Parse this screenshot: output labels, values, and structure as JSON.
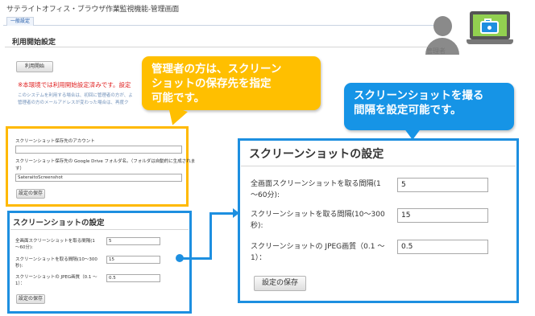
{
  "app": {
    "title": "サテライトオフィス・ブラウザ作業監視機能-管理画面",
    "tab_general": "一般設定"
  },
  "usage": {
    "title": "利用開始設定",
    "start_button": "利用開始",
    "warning": "※本環境では利用開始設定済みです。設定",
    "note_line_1": "このシステムを利用する場合は、初回に管理者の方が、よ",
    "note_line_2": "管理者の方のメールアドレスが変わった場合は、再度ク"
  },
  "account": {
    "account_label": "スクリーンショット保存先のアカウント",
    "account_value": "",
    "folder_label": "スクリーンショット保存先の Google Drive フォルダ名。（フォルダは自動的に生成されま",
    "folder_label_line_2": "す）",
    "folder_value": "SateraitoScreenshot",
    "save_button": "設定の保存"
  },
  "screenshot_small": {
    "title": "スクリーンショットの設定",
    "full_interval_label_1": "全画面スクリーンショットを取る間隔(1",
    "full_interval_label_2": "～60分):",
    "full_interval_value": "5",
    "interval_label_1": "スクリーンショットを取る間隔(10～300",
    "interval_label_2": "秒):",
    "interval_value": "15",
    "jpeg_label_1": "スクリーンショットの JPEG画質（0.1 ～",
    "jpeg_label_2": "1）：",
    "jpeg_value": "0.5",
    "save_button": "設定の保存"
  },
  "screenshot_zoom": {
    "title": "スクリーンショットの設定",
    "full_interval_label_1": "全画面スクリーンショットを取る間隔(1",
    "full_interval_label_2": "～60分):",
    "full_interval_value": "5",
    "interval_label_1": "スクリーンショットを取る間隔(10～300",
    "interval_label_2": "秒):",
    "interval_value": "15",
    "jpeg_label_1": "スクリーンショットの JPEG画質（0.1 ～",
    "jpeg_label_2": "1）：",
    "jpeg_value": "0.5",
    "save_button": "設定の保存"
  },
  "callouts": {
    "orange_line_1": "管理者の方は、スクリーン",
    "orange_line_2": "ショットの保存先を指定",
    "orange_line_3": "可能です。",
    "blue_line_1": "スクリーンショットを撮る",
    "blue_line_2": "間隔を設定可能です。"
  },
  "icons": {
    "admin_icon": "person-silhouette-icon",
    "laptop_icon": "laptop-camera-icon"
  },
  "admin_label": "管理者",
  "colors": {
    "callout_orange": "#ffbf00",
    "highlight_blue": "#1d8fe0",
    "warning_red": "#e02020",
    "laptop_green": "#92d050"
  }
}
